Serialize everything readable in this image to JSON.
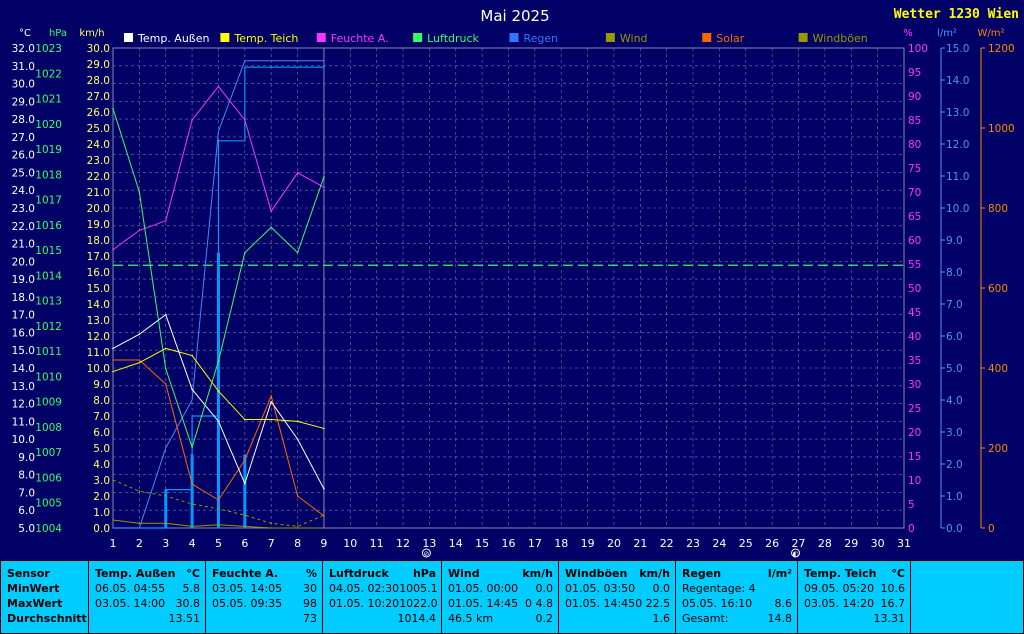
{
  "site_title": "Wetter 1230 Wien",
  "chart_data": {
    "type": "line",
    "title": "Mai 2025",
    "x": [
      1,
      2,
      3,
      4,
      5,
      6,
      7,
      8,
      9
    ],
    "x_ticks": [
      1,
      2,
      3,
      4,
      5,
      6,
      7,
      8,
      9,
      10,
      11,
      12,
      13,
      14,
      15,
      16,
      17,
      18,
      19,
      20,
      21,
      22,
      23,
      24,
      25,
      26,
      27,
      28,
      29,
      30,
      31
    ],
    "xlim": [
      1,
      31
    ],
    "left_axes": [
      {
        "unit": "°C",
        "min": 5,
        "max": 32,
        "step": 1,
        "color": "#ffffff",
        "decimals": 1
      },
      {
        "unit": "hPa",
        "min": 1004,
        "max": 1023,
        "step": 1,
        "color": "#33ff66",
        "decimals": 0
      },
      {
        "unit": "km/h",
        "min": 0,
        "max": 30,
        "step": 1,
        "color": "#ffff66",
        "decimals": 1
      }
    ],
    "right_axes": [
      {
        "unit": "%",
        "min": 0,
        "max": 100,
        "step": 5,
        "color": "#ff33ff",
        "decimals": 0
      },
      {
        "unit": "l/m²",
        "min": 0,
        "max": 15,
        "step": 1,
        "color": "#4499ff",
        "decimals": 1
      },
      {
        "unit": "W/m²",
        "min": 0,
        "max": 1200,
        "step": 200,
        "color": "#ff8800",
        "decimals": 0
      }
    ],
    "reference_line": {
      "axis": "hPa",
      "value": 1014.4,
      "color": "#33ff66"
    },
    "series": [
      {
        "name": "Temp. Außen",
        "axis": "°C",
        "color": "#ffffff",
        "values": [
          15.1,
          15.9,
          17.0,
          12.8,
          11.0,
          7.5,
          12.1,
          10.0,
          7.2
        ]
      },
      {
        "name": "Temp. Teich",
        "axis": "°C",
        "color": "#ffff00",
        "values": [
          13.8,
          14.3,
          15.1,
          14.7,
          12.7,
          11.1,
          11.1,
          11.0,
          10.6
        ]
      },
      {
        "name": "Feuchte A.",
        "axis": "%",
        "color": "#ff33ff",
        "values": [
          58,
          62,
          64,
          85,
          92,
          85,
          66,
          74,
          71
        ]
      },
      {
        "name": "Luftdruck",
        "axis": "hPa",
        "color": "#33ff66",
        "values": [
          1020.6,
          1017.3,
          1010.3,
          1007.2,
          1010.6,
          1014.9,
          1015.9,
          1014.9,
          1017.9
        ]
      },
      {
        "name": "Regen",
        "axis": "l/m²",
        "type": "bar-step",
        "color": "#0099ff",
        "values": [
          0.0,
          0.0,
          1.2,
          2.3,
          8.6,
          2.3,
          0.0,
          0.0,
          0.0
        ],
        "cumulative": [
          0.0,
          0.0,
          1.2,
          3.5,
          12.1,
          14.4,
          14.4,
          14.4,
          14.4
        ]
      },
      {
        "name": "Regen",
        "axis": "l/m²",
        "type": "line",
        "color": "#4488ff",
        "values": [
          0.0,
          0.0,
          2.5,
          4.0,
          12.4,
          14.6,
          14.6,
          14.6,
          14.6
        ]
      },
      {
        "name": "Wind",
        "axis": "km/h",
        "color": "#999900",
        "values": [
          0.5,
          0.3,
          0.3,
          0.1,
          0.2,
          0.1,
          0.0,
          0.0,
          0.0
        ]
      },
      {
        "name": "Solar",
        "axis": "W/m²",
        "color": "#ff6600",
        "values": [
          420,
          420,
          360,
          110,
          70,
          170,
          330,
          80,
          30
        ]
      },
      {
        "name": "Windböen",
        "axis": "km/h",
        "color": "#999900",
        "dashed": true,
        "values": [
          3.0,
          2.3,
          2.0,
          1.5,
          1.2,
          0.8,
          0.3,
          0.1,
          0.8
        ]
      }
    ],
    "moon_phases": [
      {
        "x": 13,
        "symbol": "⊘"
      },
      {
        "x": 27,
        "symbol": "◐"
      }
    ]
  },
  "stats": {
    "labels": {
      "sensor": "Sensor",
      "min": "MinWert",
      "max": "MaxWert",
      "avg": "Durchschnitt"
    },
    "cells": [
      {
        "name": "Temp. Außen",
        "unit": "°C",
        "rows": [
          [
            "06.05.  04:55",
            "5.8"
          ],
          [
            "03.05.  14:00",
            "30.8"
          ],
          [
            "",
            "13.51"
          ]
        ]
      },
      {
        "name": "Feuchte A.",
        "unit": "%",
        "rows": [
          [
            "03.05.  14:05",
            "30"
          ],
          [
            "05.05.  09:35",
            "98"
          ],
          [
            "",
            "73"
          ]
        ]
      },
      {
        "name": "Luftdruck",
        "unit": "hPa",
        "rows": [
          [
            "04.05.  02:30",
            "1005.1"
          ],
          [
            "01.05.  10:20",
            "1022.0"
          ],
          [
            "",
            "1014.4"
          ]
        ]
      },
      {
        "name": "Wind",
        "unit": "km/h",
        "rows": [
          [
            "01.05.  00:00",
            "0.0"
          ],
          [
            "01.05.  14:45",
            "0 4.8"
          ],
          [
            "46.5 km",
            "0.2"
          ]
        ]
      },
      {
        "name": "Windböen",
        "unit": "km/h",
        "rows": [
          [
            "01.05.  03:50",
            "0.0"
          ],
          [
            "01.05.  14:45",
            "0 22.5"
          ],
          [
            "",
            "1.6"
          ]
        ]
      },
      {
        "name": "Regen",
        "unit": "l/m²",
        "rows": [
          [
            "Regentage: 4",
            ""
          ],
          [
            "05.05.  16:10",
            "8.6"
          ],
          [
            "Gesamt:",
            "14.8"
          ]
        ]
      },
      {
        "name": "Temp. Teich",
        "unit": "°C",
        "rows": [
          [
            "09.05.  05:20",
            "10.6"
          ],
          [
            "03.05.  14:20",
            "16.7"
          ],
          [
            "",
            "13.31"
          ]
        ]
      }
    ]
  }
}
